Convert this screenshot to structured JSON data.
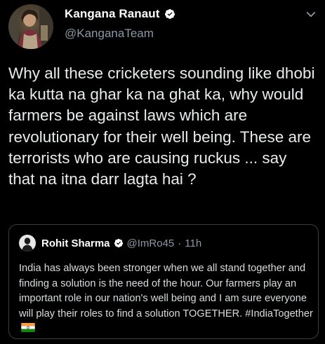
{
  "colors": {
    "background": "#000000",
    "text": "#e7e9ea",
    "secondary": "#8b98a5",
    "verified": "#1d9bf0",
    "border": "#3a3d40"
  },
  "tweet": {
    "display_name": "Kangana Ranaut",
    "handle": "@KanganaTeam",
    "verified_icon": "verified-badge-icon",
    "more_icon": "chevron-down-icon",
    "text": "Why all these cricketers sounding like dhobi ka kutta na ghar ka na ghat ka, why would farmers be against laws which are revolutionary for their well being. These are terrorists who are causing ruckus ... say that na itna darr lagta hai ?"
  },
  "quoted": {
    "display_name": "Rohit Sharma",
    "handle": "@ImRo45",
    "separator": "·",
    "time": "11h",
    "verified_icon": "verified-badge-icon",
    "text": "India has always been stronger when we all stand together and finding a solution is the need of the hour. Our farmers play an important role in our nation's well being and I am sure everyone will play their roles to find a solution TOGETHER. #IndiaTogether",
    "flag_icon": "india-flag-icon"
  }
}
